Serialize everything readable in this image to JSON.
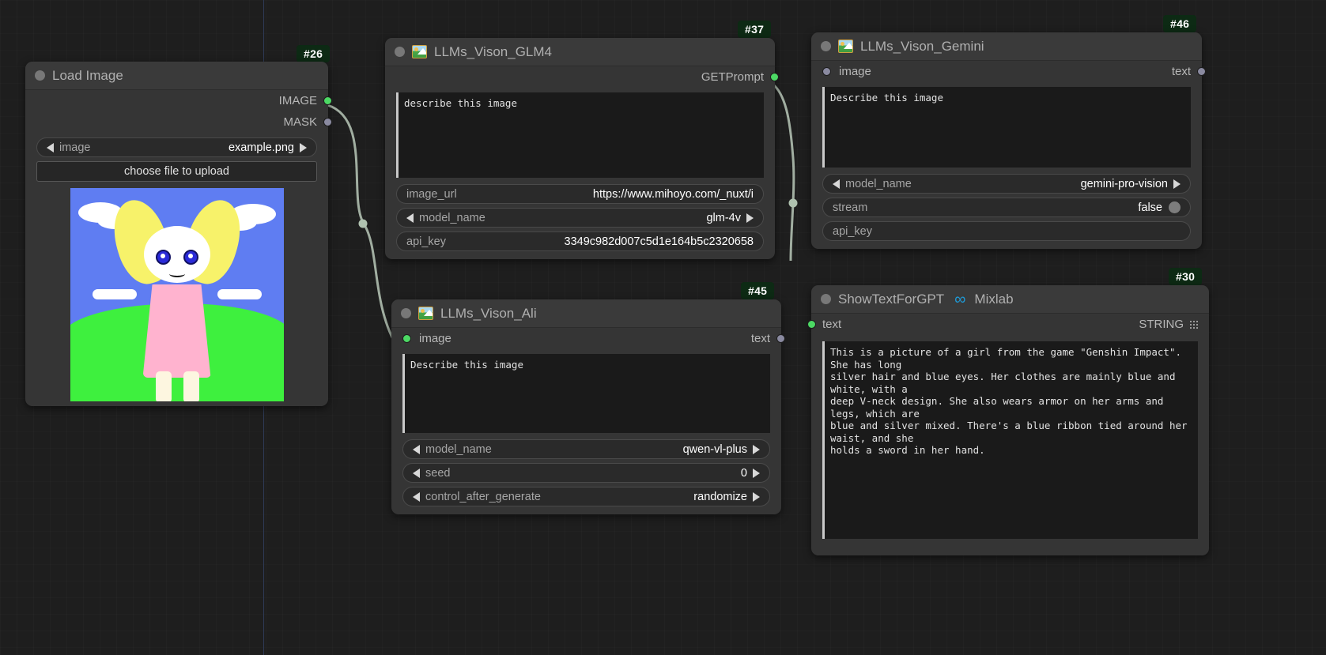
{
  "app": {
    "canvas_label": "ComfyUI node graph canvas"
  },
  "nodes": {
    "load_image": {
      "badge": "#26",
      "title": "Load Image",
      "outputs": [
        {
          "label": "IMAGE",
          "color": "green"
        },
        {
          "label": "MASK",
          "color": "grey"
        }
      ],
      "widgets": {
        "image_label": "image",
        "image_value": "example.png",
        "upload_button": "choose file to upload"
      }
    },
    "glm4": {
      "badge": "#37",
      "title": "LLMs_Vison_GLM4",
      "icon": "image-thumbnail-icon",
      "outputs": [
        {
          "label": "GETPrompt",
          "color": "green"
        }
      ],
      "prompt_text": "describe this image",
      "widgets": [
        {
          "label": "image_url",
          "value": "https://www.mihoyo.com/_nuxt/i",
          "type": "text"
        },
        {
          "label": "model_name",
          "value": "glm-4v",
          "type": "combo"
        },
        {
          "label": "api_key",
          "value": "3349c982d007c5d1e164b5c2320658",
          "type": "text"
        }
      ]
    },
    "gemini": {
      "badge": "#46",
      "title": "LLMs_Vison_Gemini",
      "icon": "image-thumbnail-icon",
      "input": {
        "label": "image",
        "color": "grey"
      },
      "output": {
        "label": "text",
        "color": "grey"
      },
      "prompt_text": "Describe this image",
      "widgets": [
        {
          "label": "model_name",
          "value": "gemini-pro-vision",
          "type": "combo"
        },
        {
          "label": "stream",
          "value": "false",
          "type": "toggle"
        },
        {
          "label": "api_key",
          "value": "",
          "type": "text"
        }
      ]
    },
    "ali": {
      "badge": "#45",
      "title": "LLMs_Vison_Ali",
      "icon": "image-thumbnail-icon",
      "input": {
        "label": "image",
        "color": "green"
      },
      "output": {
        "label": "text",
        "color": "grey"
      },
      "prompt_text": "Describe this image",
      "widgets": [
        {
          "label": "model_name",
          "value": "qwen-vl-plus",
          "type": "combo"
        },
        {
          "label": "seed",
          "value": "0",
          "type": "combo"
        },
        {
          "label": "control_after_generate",
          "value": "randomize",
          "type": "combo"
        }
      ]
    },
    "show_text": {
      "badge": "#30",
      "title": "ShowTextForGPT",
      "title_suffix": "Mixlab",
      "infinity_glyph": "∞",
      "input": {
        "label": "text",
        "color": "green"
      },
      "output": {
        "label": "STRING",
        "color": "none"
      },
      "result_text": "This is a picture of a girl from the game \"Genshin Impact\". She has long\nsilver hair and blue eyes. Her clothes are mainly blue and white, with a\ndeep V-neck design. She also wears armor on her arms and legs, which are\nblue and silver mixed. There's a blue ribbon tied around her waist, and she\nholds a sword in her hand."
    }
  },
  "colors": {
    "link": "#b8c8b8",
    "slot_green": "#4cd964",
    "slot_grey": "#8a8aa0",
    "badge_bg": "#0d2a14",
    "node_bg": "#353535",
    "mixlab_blue": "#1e9bd8"
  }
}
